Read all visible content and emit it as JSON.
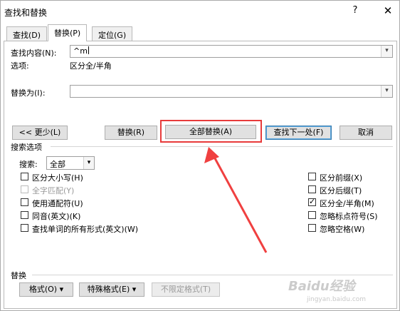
{
  "window": {
    "title": "查找和替换",
    "help": "?",
    "close": "✕"
  },
  "tabs": [
    {
      "label": "查找(D)"
    },
    {
      "label": "替换(P)"
    },
    {
      "label": "定位(G)"
    }
  ],
  "find": {
    "label": "查找内容(N):",
    "value": "^m",
    "options_label": "选项:",
    "options_value": "区分全/半角"
  },
  "replace": {
    "label": "替换为(I):",
    "value": ""
  },
  "buttons": {
    "less": "<< 更少(L)",
    "replace": "替换(R)",
    "replace_all": "全部替换(A)",
    "find_next": "查找下一处(F)",
    "cancel": "取消"
  },
  "search_options": {
    "title": "搜索选项",
    "search_label": "搜索:",
    "search_value": "全部",
    "left": [
      {
        "label": "区分大小写(H)",
        "checked": false,
        "disabled": false
      },
      {
        "label": "全字匹配(Y)",
        "checked": false,
        "disabled": true
      },
      {
        "label": "使用通配符(U)",
        "checked": false,
        "disabled": false
      },
      {
        "label": "同音(英文)(K)",
        "checked": false,
        "disabled": false
      },
      {
        "label": "查找单词的所有形式(英文)(W)",
        "checked": false,
        "disabled": false
      }
    ],
    "right": [
      {
        "label": "区分前缀(X)",
        "checked": false
      },
      {
        "label": "区分后缀(T)",
        "checked": false
      },
      {
        "label": "区分全/半角(M)",
        "checked": true
      },
      {
        "label": "忽略标点符号(S)",
        "checked": false
      },
      {
        "label": "忽略空格(W)",
        "checked": false
      }
    ]
  },
  "replace_section": {
    "title": "替换",
    "format": "格式(O) ▾",
    "special": "特殊格式(E) ▾",
    "no_format": "不限定格式(T)"
  },
  "watermark": {
    "brand": "Baidu经验",
    "url": "jingyan.baidu.com"
  },
  "colors": {
    "highlight": "#e83b3b",
    "arrow": "#f04040"
  }
}
